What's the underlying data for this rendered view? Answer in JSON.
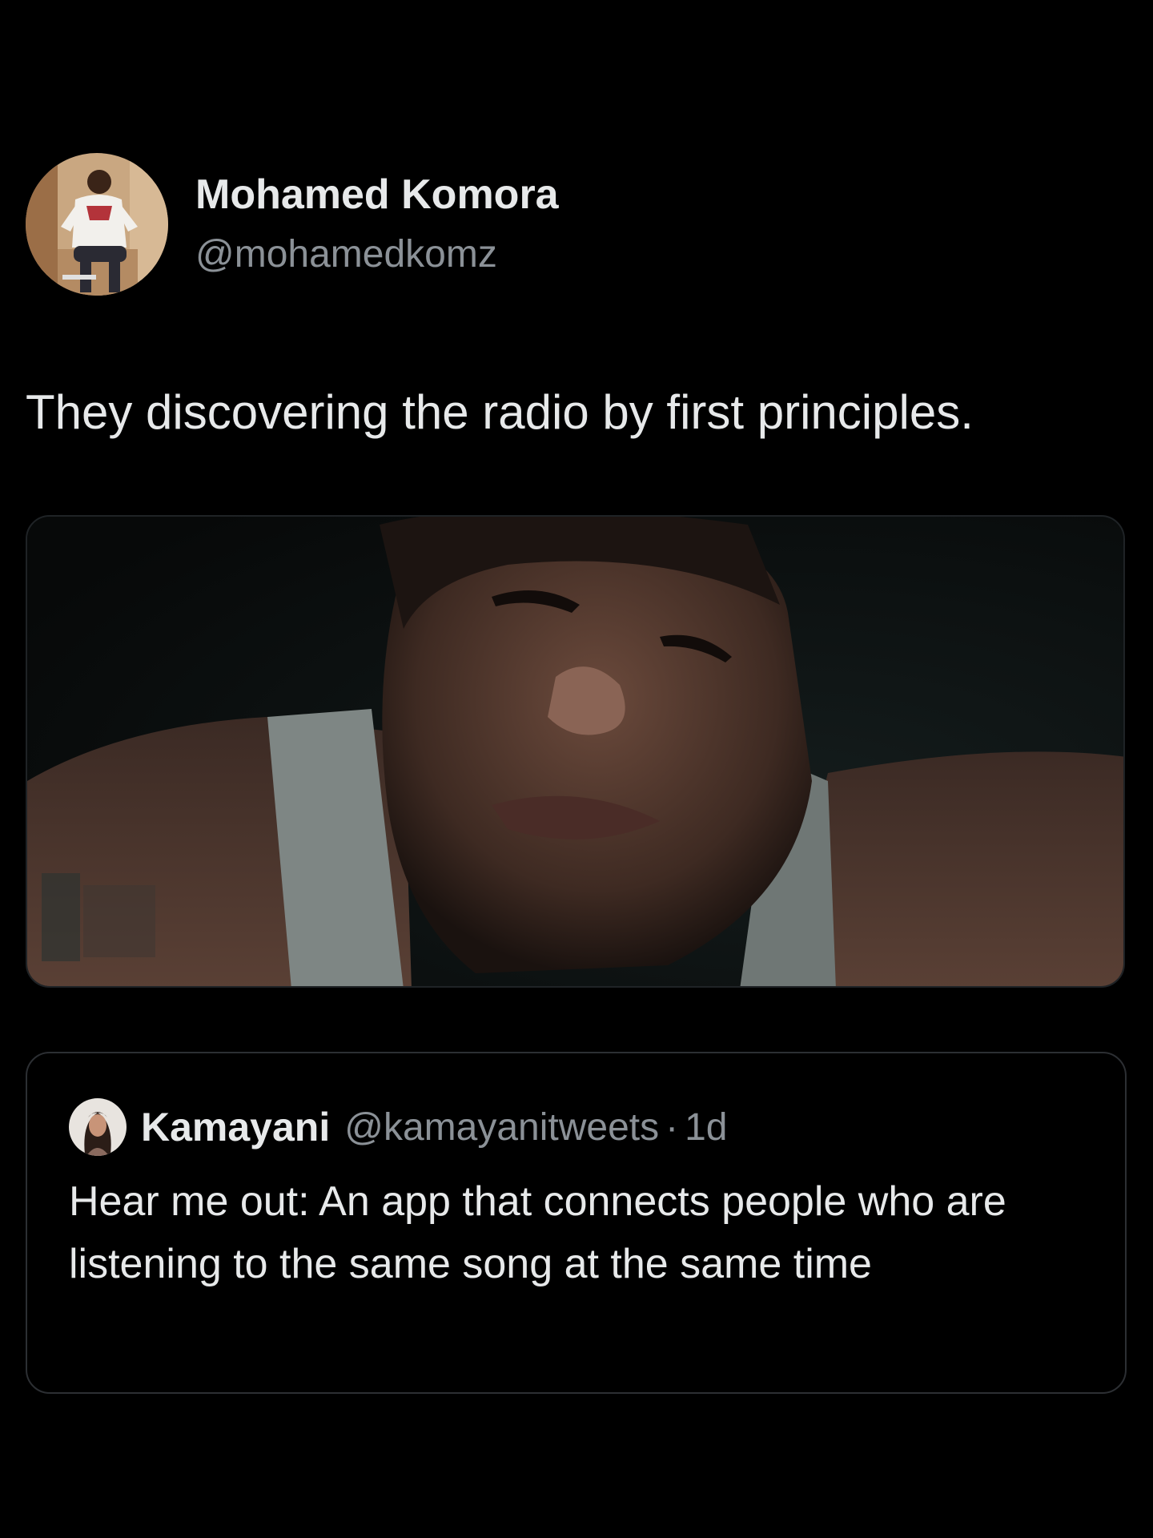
{
  "tweet": {
    "author": {
      "display_name": "Mohamed Komora",
      "handle": "@mohamedkomz",
      "avatar_icon": "profile-photo"
    },
    "text": "They discovering the radio by first principles.",
    "media": {
      "type": "video-still",
      "icon": "media-image"
    }
  },
  "quoted_tweet": {
    "author": {
      "display_name": "Kamayani",
      "handle": "@kamayanitweets",
      "avatar_icon": "profile-photo"
    },
    "separator": "·",
    "time": "1d",
    "text": "Hear me out: An app that connects people who are listening to the same song at the same time"
  },
  "colors": {
    "background": "#000000",
    "primary_text": "#e7e9ea",
    "secondary_text": "#8b9197",
    "border": "#2c2f33"
  }
}
